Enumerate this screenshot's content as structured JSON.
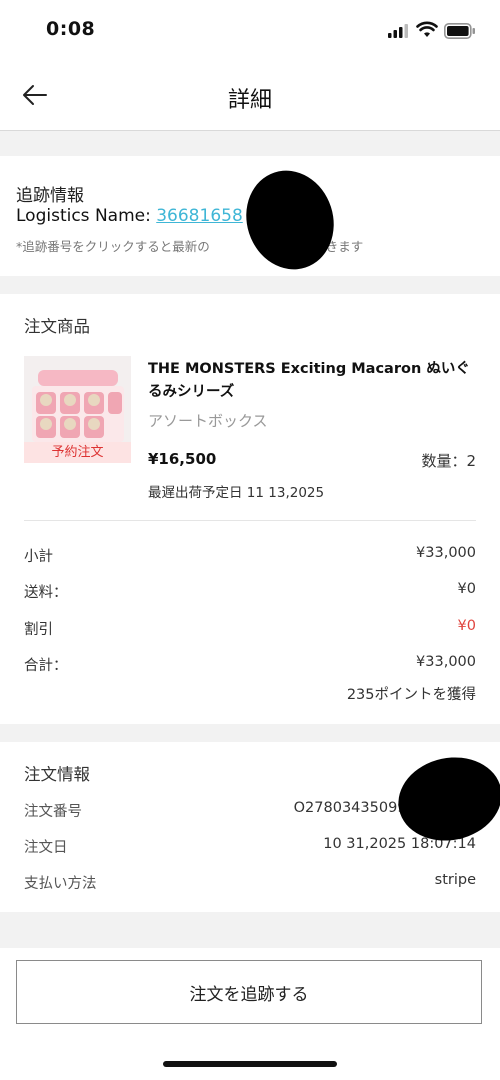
{
  "status_bar": {
    "time": "0:08"
  },
  "nav": {
    "title": "詳細"
  },
  "tracking": {
    "title": "追跡情報",
    "logistics_label": "Logistics Name: ",
    "tracking_number": "36681658",
    "note": "*追跡番号をクリックすると最新の",
    "note_tail": "が確認できます"
  },
  "order_items": {
    "title": "注文商品",
    "product": {
      "name": "THE MONSTERS Exciting Macaron ぬいぐるみシリーズ",
      "variant": "アソートボックス",
      "price": "¥16,500",
      "quantity": "数量：2",
      "preorder_badge": "予約注文",
      "shipping_date": "最遅出荷予定日 11 13,2025"
    },
    "summary": [
      {
        "label": "小計",
        "value": "¥33,000"
      },
      {
        "label": "送料：",
        "value": "¥0"
      },
      {
        "label": "割引",
        "value": "¥0"
      },
      {
        "label": "合計：",
        "value": "¥33,000"
      }
    ],
    "points": "235ポイントを獲得"
  },
  "order_info": {
    "title": "注文情報",
    "rows": [
      {
        "label": "注文番号",
        "value": "O27803435099638/1114"
      },
      {
        "label": "注文日",
        "value": "10 31,2025 18:07:14"
      },
      {
        "label": "支払い方法",
        "value": "stripe"
      }
    ]
  },
  "actions": {
    "track_order": "注文を追跡する"
  },
  "colors": {
    "link": "#3fb6d6",
    "discount": "#e0443e",
    "preorder_bg": "#fde3e3"
  },
  "icons": {
    "back": "arrow-left-icon",
    "signal": "cellular-signal-icon",
    "wifi": "wifi-icon",
    "battery": "battery-icon"
  }
}
